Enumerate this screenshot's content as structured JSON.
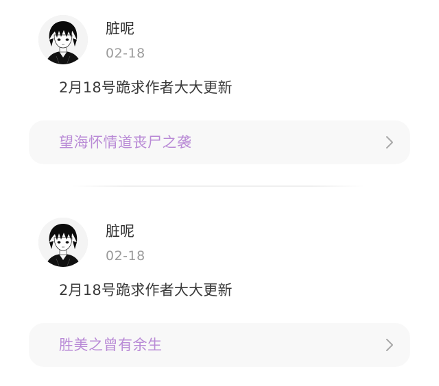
{
  "posts": [
    {
      "user": {
        "name": "脏呢",
        "avatar_icon": "anime-avatar-icon"
      },
      "date": "02-18",
      "content": "2月18号跪求作者大大更新",
      "book": {
        "title": "望海怀情道丧尸之袭",
        "chevron_icon": "chevron-right-icon"
      }
    },
    {
      "user": {
        "name": "脏呢",
        "avatar_icon": "anime-avatar-icon"
      },
      "date": "02-18",
      "content": "2月18号跪求作者大大更新",
      "book": {
        "title": "胜美之曾有余生",
        "chevron_icon": "chevron-right-icon"
      }
    }
  ],
  "colors": {
    "book_title": "#b98ad6",
    "card_background": "#f8f8f8",
    "date": "#9b9b9b",
    "text": "#3a3a3a"
  }
}
